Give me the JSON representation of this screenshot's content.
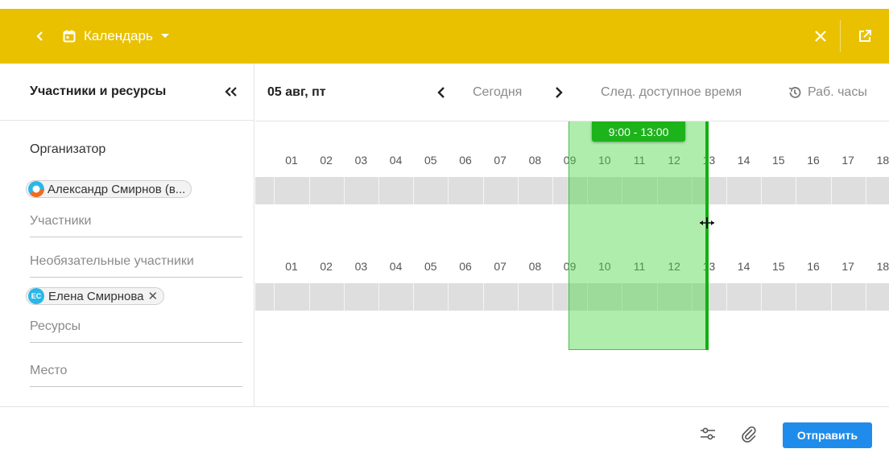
{
  "header": {
    "title": "Календарь",
    "bg_color": "#e9c100",
    "icons": [
      "back-icon",
      "calendar-icon",
      "caret-down-icon",
      "close-icon",
      "open-external-icon"
    ]
  },
  "left_panel": {
    "title": "Участники и ресурсы",
    "organizer_label": "Организатор",
    "organizer_chip": "Александр Смирнов (в...",
    "participants_placeholder": "Участники",
    "optional_label": "Необязательные участники",
    "optional_chip": {
      "initials": "ЕС",
      "name": "Елена Смирнова",
      "remove": "✕"
    },
    "resources_placeholder": "Ресурсы",
    "place_placeholder": "Место"
  },
  "toolbar": {
    "date": "05 авг, пт",
    "today": "Сегодня",
    "next_free": "След. доступное время",
    "work_hours": "Раб. часы"
  },
  "timeline": {
    "hours_row1": [
      "01",
      "02",
      "03",
      "04",
      "05",
      "06",
      "07",
      "08",
      "09",
      "10",
      "11",
      "12",
      "13",
      "14",
      "15",
      "16",
      "17",
      "18"
    ],
    "hours_row2": [
      "01",
      "02",
      "03",
      "04",
      "05",
      "06",
      "07",
      "08",
      "09",
      "10",
      "11",
      "12",
      "13",
      "14",
      "15",
      "16",
      "17",
      "18"
    ],
    "selection_label": "9:00 - 13:00",
    "selection_start_hour": 9,
    "selection_end_hour": 13,
    "selection_color": "#4cd648"
  },
  "footer": {
    "send_label": "Отправить",
    "send_color": "#1f8ceb"
  }
}
